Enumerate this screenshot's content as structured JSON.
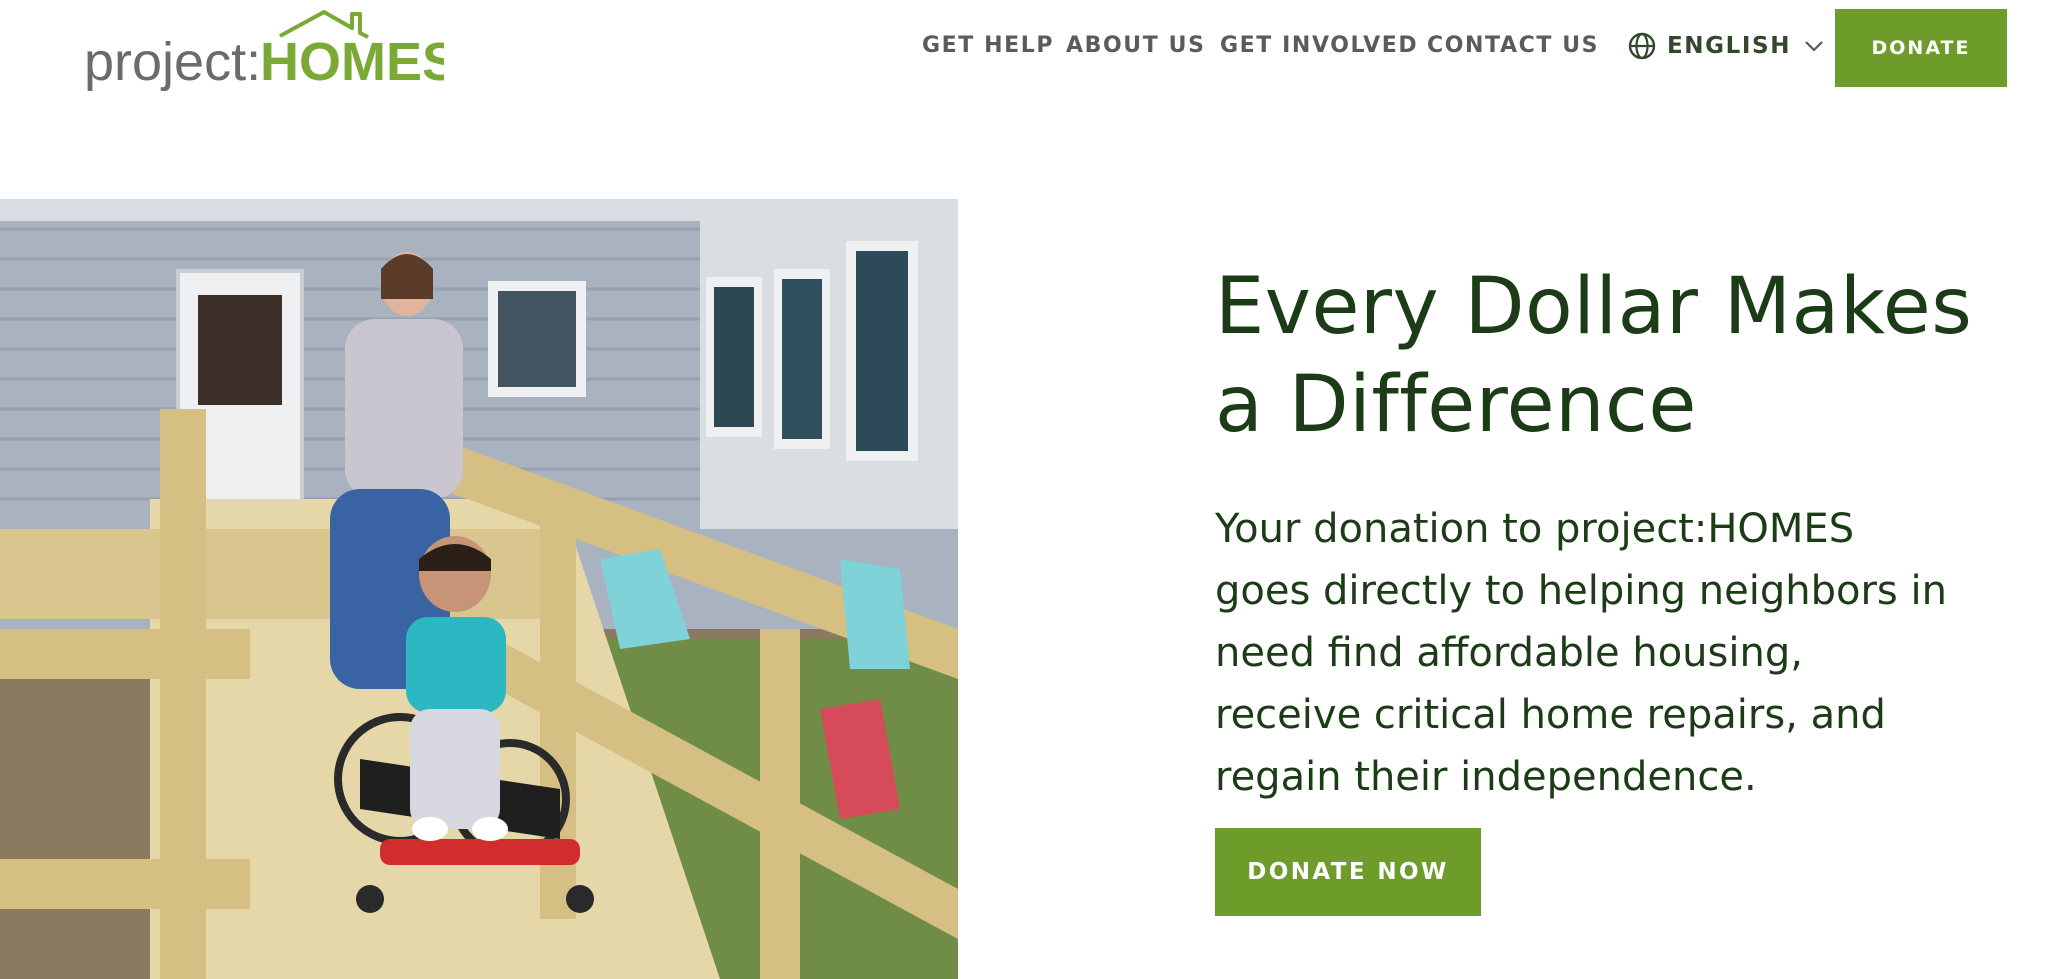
{
  "brand": {
    "logo_text_prefix": "project:",
    "logo_text_main": "HOMES",
    "logo_color_gray": "#6b6b6b",
    "logo_color_green": "#7aaa35"
  },
  "nav": {
    "items": [
      {
        "label": "GET HELP"
      },
      {
        "label": "ABOUT US"
      },
      {
        "label": "GET INVOLVED"
      },
      {
        "label": "CONTACT US"
      }
    ],
    "language": {
      "label": "ENGLISH",
      "icon": "globe-icon"
    },
    "donate_label": "DONATE"
  },
  "hero": {
    "title": "Every Dollar Makes a Difference",
    "body": "Your donation to project:HOMES goes directly to helping neighbors in need find affordable housing, receive critical home repairs, and regain their independence.",
    "cta_label": "DONATE NOW"
  },
  "colors": {
    "accent_green": "#6e9c2b",
    "heading_dark_green": "#1c3b17",
    "nav_gray": "#5b5b5b"
  }
}
